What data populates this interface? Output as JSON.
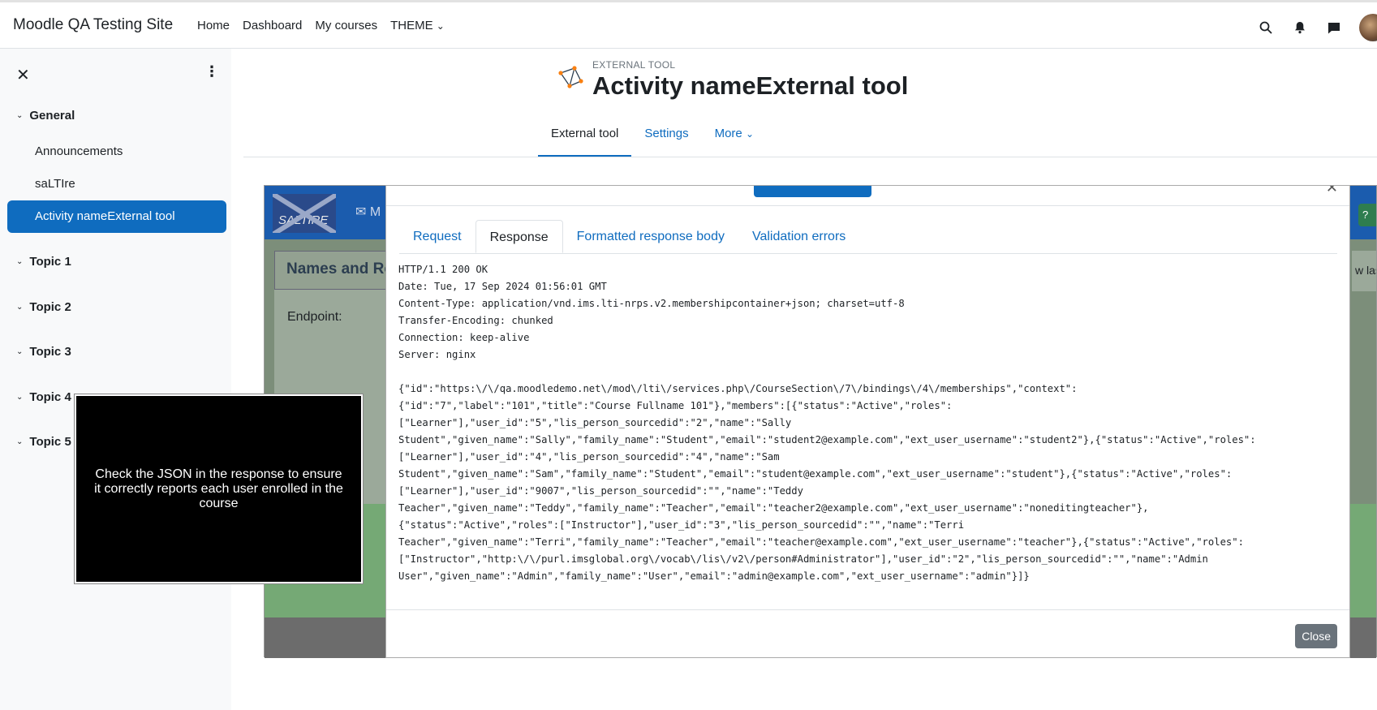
{
  "topbar": {
    "site_name": "Moodle QA Testing Site",
    "nav": [
      "Home",
      "Dashboard",
      "My courses",
      "THEME"
    ],
    "theme_chevron": "⌄",
    "icons": [
      "search-icon",
      "bell-icon",
      "chat-icon",
      "avatar"
    ]
  },
  "drawer": {
    "close_glyph": "✕",
    "menu_glyph": "⋮",
    "sections": [
      {
        "label": "General"
      },
      {
        "label": "Topic 1"
      },
      {
        "label": "Topic 2"
      },
      {
        "label": "Topic 3"
      },
      {
        "label": "Topic 4"
      },
      {
        "label": "Topic 5"
      }
    ],
    "general_items": [
      "Announcements",
      "saLTIre",
      "Activity nameExternal tool"
    ],
    "active_item": "Activity nameExternal tool"
  },
  "header": {
    "subtitle": "EXTERNAL TOOL",
    "title": "Activity nameExternal tool",
    "tabs": [
      "External tool",
      "Settings",
      "More"
    ],
    "active_tab": "External tool"
  },
  "frame": {
    "logo_text": "SALTIRE",
    "panel_title": "Names and Ro",
    "endpoint_label": "Endpoint:",
    "right_fragment": "w last"
  },
  "modal": {
    "tabs": [
      "Request",
      "Response",
      "Formatted response body",
      "Validation errors"
    ],
    "active_tab": "Response",
    "response_lines": [
      "HTTP/1.1 200 OK",
      "Date: Tue, 17 Sep 2024 01:56:01 GMT",
      "Content-Type: application/vnd.ims.lti-nrps.v2.membershipcontainer+json; charset=utf-8",
      "Transfer-Encoding: chunked",
      "Connection: keep-alive",
      "Server: nginx",
      "",
      "{\"id\":\"https:\\/\\/qa.moodledemo.net\\/mod\\/lti\\/services.php\\/CourseSection\\/7\\/bindings\\/4\\/memberships\",\"context\":",
      "{\"id\":\"7\",\"label\":\"101\",\"title\":\"Course Fullname 101\"},\"members\":[{\"status\":\"Active\",\"roles\":",
      "[\"Learner\"],\"user_id\":\"5\",\"lis_person_sourcedid\":\"2\",\"name\":\"Sally",
      "Student\",\"given_name\":\"Sally\",\"family_name\":\"Student\",\"email\":\"student2@example.com\",\"ext_user_username\":\"student2\"},{\"status\":\"Active\",\"roles\":",
      "[\"Learner\"],\"user_id\":\"4\",\"lis_person_sourcedid\":\"4\",\"name\":\"Sam",
      "Student\",\"given_name\":\"Sam\",\"family_name\":\"Student\",\"email\":\"student@example.com\",\"ext_user_username\":\"student\"},{\"status\":\"Active\",\"roles\":",
      "[\"Learner\"],\"user_id\":\"9007\",\"lis_person_sourcedid\":\"\",\"name\":\"Teddy",
      "Teacher\",\"given_name\":\"Teddy\",\"family_name\":\"Teacher\",\"email\":\"teacher2@example.com\",\"ext_user_username\":\"noneditingteacher\"},",
      "{\"status\":\"Active\",\"roles\":[\"Instructor\"],\"user_id\":\"3\",\"lis_person_sourcedid\":\"\",\"name\":\"Terri",
      "Teacher\",\"given_name\":\"Terri\",\"family_name\":\"Teacher\",\"email\":\"teacher@example.com\",\"ext_user_username\":\"teacher\"},{\"status\":\"Active\",\"roles\":",
      "[\"Instructor\",\"http:\\/\\/purl.imsglobal.org\\/vocab\\/lis\\/v2\\/person#Administrator\"],\"user_id\":\"2\",\"lis_person_sourcedid\":\"\",\"name\":\"Admin",
      "User\",\"given_name\":\"Admin\",\"family_name\":\"User\",\"email\":\"admin@example.com\",\"ext_user_username\":\"admin\"}]}"
    ],
    "close_label": "Close"
  },
  "tooltip": {
    "text": "Check the JSON in the response to ensure it correctly reports each user enrolled in the course"
  },
  "colors": {
    "primary": "#0f6cbf",
    "drawer_bg": "#f8f9fa",
    "frame_band": "#1b5cae",
    "frame_green": "#75a975"
  }
}
